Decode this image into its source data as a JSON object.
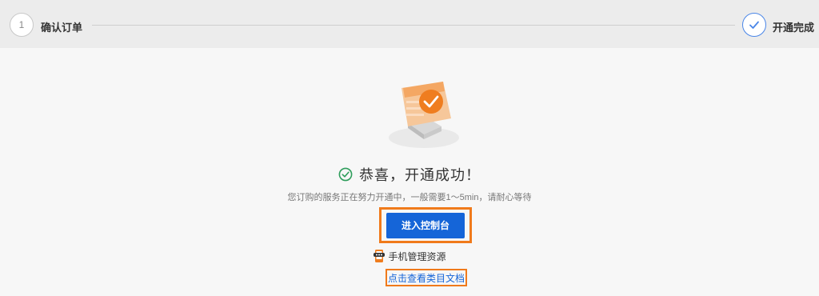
{
  "steps": [
    {
      "number": "1",
      "label": "确认订单",
      "state": "pending"
    },
    {
      "label": "开通完成",
      "state": "done"
    }
  ],
  "result": {
    "title": "恭喜，开通成功！",
    "subtitle": "您订购的服务正在努力开通中，一般需要1～5min，请耐心等待"
  },
  "actions": {
    "console_label": "进入控制台",
    "mobile_label": "手机管理资源",
    "doc_link_label": "点击查看类目文档"
  },
  "colors": {
    "accent": "#1565d8",
    "highlight": "#f07a1b",
    "success": "#2e9d5b"
  },
  "icons": {
    "success": "check-circle-icon",
    "step_done": "check-icon",
    "mobile": "mobile-phone-icon"
  }
}
